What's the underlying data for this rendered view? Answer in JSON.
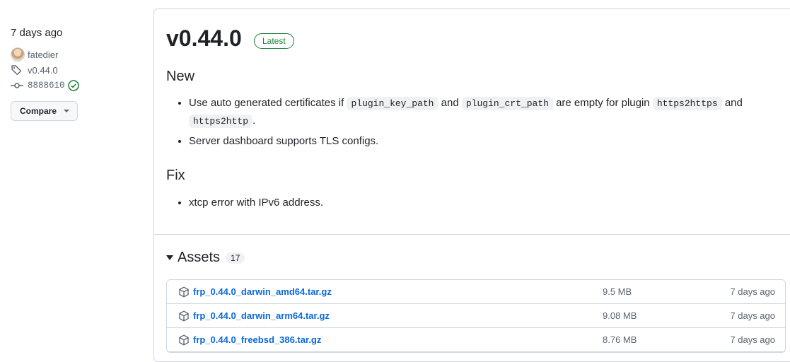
{
  "sidebar": {
    "date": "7 days ago",
    "author": "fatedier",
    "tag": "v0.44.0",
    "commit": "8888610",
    "compare_label": "Compare"
  },
  "release": {
    "title": "v0.44.0",
    "badge": "Latest",
    "sections": {
      "new_heading": "New",
      "new_item1": {
        "t1": "Use auto generated certificates if",
        "c1": "plugin_key_path",
        "t2": "and",
        "c2": "plugin_crt_path",
        "t3": "are empty for plugin",
        "c3": "https2https",
        "t4": "and",
        "c4": "https2http",
        "t5": "."
      },
      "new_item2": "Server dashboard supports TLS configs.",
      "fix_heading": "Fix",
      "fix_item1": "xtcp error with IPv6 address."
    }
  },
  "assets": {
    "title": "Assets",
    "count": "17",
    "rows": [
      {
        "name": "frp_0.44.0_darwin_amd64.tar.gz",
        "size": "9.5 MB",
        "date": "7 days ago"
      },
      {
        "name": "frp_0.44.0_darwin_arm64.tar.gz",
        "size": "9.08 MB",
        "date": "7 days ago"
      },
      {
        "name": "frp_0.44.0_freebsd_386.tar.gz",
        "size": "8.76 MB",
        "date": "7 days ago"
      }
    ]
  },
  "colors": {
    "link": "#0969da",
    "success": "#1a7f37",
    "border": "#d0d7de"
  }
}
